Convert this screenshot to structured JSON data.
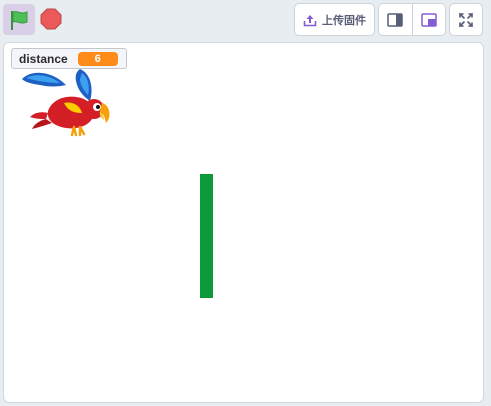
{
  "toolbar": {
    "green_flag_icon": "green-flag-icon",
    "stop_icon": "stop-sign-icon",
    "upload_label": "上传固件",
    "upload_icon": "upload-icon",
    "layout_small_icon": "small-stage-icon",
    "layout_large_icon": "large-stage-icon",
    "fullscreen_icon": "fullscreen-icon"
  },
  "stage": {
    "monitor": {
      "label": "distance",
      "value": "6"
    },
    "sprites": [
      "parrot",
      "green-wall"
    ]
  },
  "colors": {
    "flag_green": "#4cbf56",
    "stop_red": "#ec5959",
    "monitor_orange": "#ff8c1a",
    "wall_green": "#0b9a3a",
    "accent_purple": "#855cd6"
  }
}
